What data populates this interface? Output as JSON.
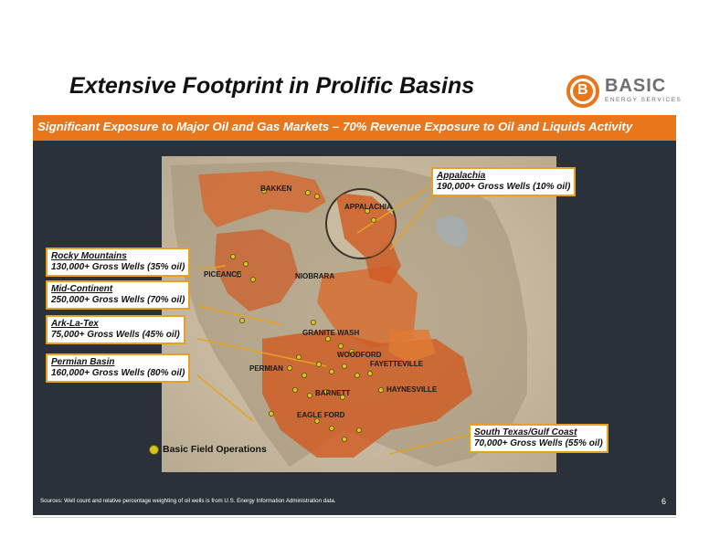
{
  "title": "Extensive Footprint in Prolific Basins",
  "logo": {
    "letter": "B",
    "word": "BASIC",
    "sub": "ENERGY SERVICES"
  },
  "banner": "Significant Exposure to Major Oil and Gas Markets – 70% Revenue Exposure to Oil and Liquids Activity",
  "map_labels": {
    "bakken": "BAKKEN",
    "appalachia": "APPALACHIA",
    "piceance": "PICEANCE",
    "niobrara": "NIOBRARA",
    "granite_wash": "GRANITE WASH",
    "woodford": "WOODFORD",
    "fayetteville": "FAYETTEVILLE",
    "permian": "PERMIAN",
    "haynesville": "HAYNESVILLE",
    "barnett": "BARNETT",
    "eagle_ford": "EAGLE FORD"
  },
  "callouts": {
    "appalachia": {
      "name": "Appalachia",
      "detail": "190,000+ Gross Wells (10% oil)"
    },
    "rocky_mountains": {
      "name": "Rocky Mountains",
      "detail": "130,000+ Gross Wells (35% oil)"
    },
    "mid_continent": {
      "name": "Mid-Continent",
      "detail": "250,000+ Gross Wells (70% oil)"
    },
    "ark_la_tex": {
      "name": "Ark-La-Tex",
      "detail": "75,000+ Gross Wells (45% oil)"
    },
    "permian_basin": {
      "name": "Permian Basin",
      "detail": "160,000+ Gross Wells (80% oil)"
    },
    "south_texas": {
      "name": "South Texas/Gulf Coast",
      "detail": "70,000+ Gross Wells (55% oil)"
    }
  },
  "legend": "Basic Field Operations",
  "sources": "Sources: Well count and relative percentage weighting of oil wells is from U.S. Energy Information Administration data.",
  "page_number": "6",
  "colors": {
    "accent": "#e8761c",
    "panel": "#2b3139",
    "callout_border": "#e8a020",
    "marker": "#d8c520"
  }
}
